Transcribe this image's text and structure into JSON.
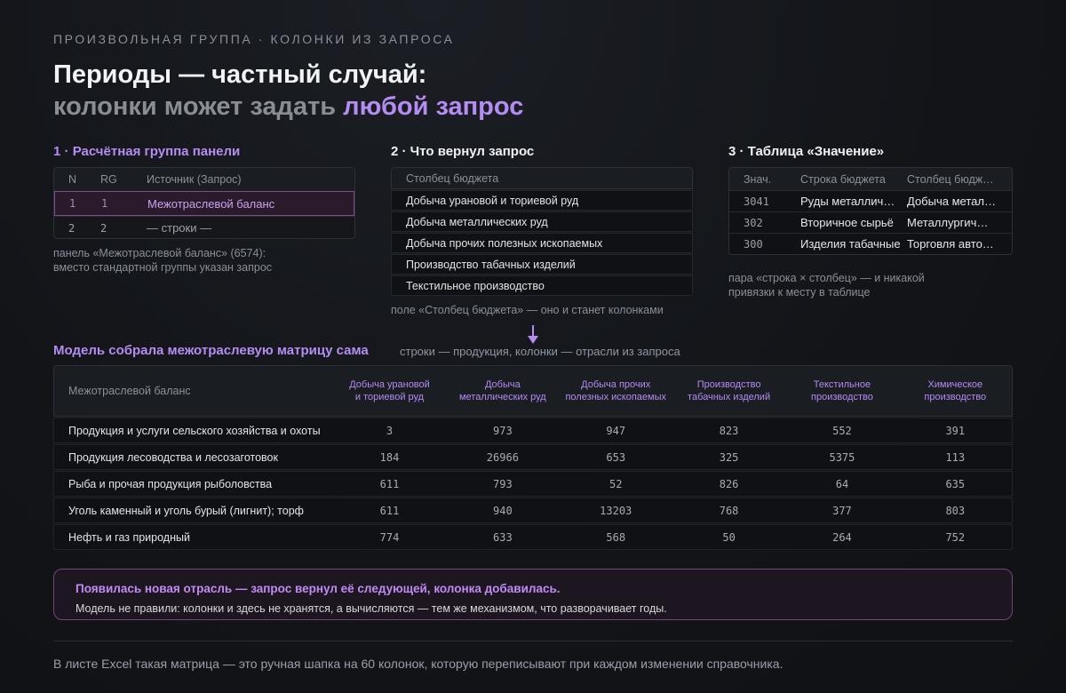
{
  "eyebrow": "ПРОИЗВОЛЬНАЯ ГРУППА · КОЛОНКИ ИЗ ЗАПРОСА",
  "title": {
    "line1": "Периоды — частный случай:",
    "line2_prefix": "колонки может задать ",
    "line2_accent": "любой запрос"
  },
  "section1": {
    "num": "1 · ",
    "title": "Расчётная группа панели",
    "headers": [
      "N",
      "RG",
      "Источник (Запрос)"
    ],
    "rows": [
      [
        "1",
        "1",
        "Межотраслевой баланс"
      ],
      [
        "2",
        "2",
        "— строки —"
      ]
    ],
    "note_line1": "панель «Межотраслевой баланс» (6574):",
    "note_line2": "вместо стандартной группы указан запрос"
  },
  "section2": {
    "title": "2 · Что вернул запрос",
    "header": "Столбец бюджета",
    "items": [
      "Добыча урановой и ториевой руд",
      "Добыча металлических руд",
      "Добыча прочих полезных ископаемых",
      "Производство табачных изделий",
      "Текстильное производство"
    ],
    "note": "поле «Столбец бюджета» — оно и станет колонками"
  },
  "section3": {
    "title": "3 · Таблица «Значение»",
    "headers": [
      "Знач.",
      "Строка бюджета",
      "Столбец бюджета"
    ],
    "rows": [
      [
        "3041",
        "Руды металлич…",
        "Добыча металл…"
      ],
      [
        "302",
        "Вторичное сырьё",
        "Металлургич…"
      ],
      [
        "300",
        "Изделия табачные",
        "Торговля авто…"
      ]
    ],
    "note_line1": "пара «строка × столбец» — и никакой",
    "note_line2": "привязки к месту в таблице"
  },
  "model": {
    "title": "Модель собрала межотраслевую матрицу сама",
    "subtitle": "строки — продукция, колонки — отрасли из запроса"
  },
  "matrix": {
    "corner": "Межотраслевой баланс",
    "columns": [
      [
        "Добыча урановой",
        "и ториевой руд"
      ],
      [
        "Добыча",
        "металлических руд"
      ],
      [
        "Добыча прочих",
        "полезных ископаемых"
      ],
      [
        "Производство",
        "табачных изделий"
      ],
      [
        "Текстильное",
        "производство"
      ],
      [
        "Химическое",
        "производство"
      ]
    ],
    "rows": [
      {
        "label": "Продукция и услуги сельского хозяйства и охоты",
        "values": [
          "3",
          "973",
          "947",
          "823",
          "552",
          "391"
        ]
      },
      {
        "label": "Продукция лесоводства и лесозаготовок",
        "values": [
          "184",
          "26966",
          "653",
          "325",
          "5375",
          "113"
        ]
      },
      {
        "label": "Рыба и прочая продукция рыболовства",
        "values": [
          "611",
          "793",
          "52",
          "826",
          "64",
          "635"
        ]
      },
      {
        "label": "Уголь каменный и уголь бурый (лигнит); торф",
        "values": [
          "611",
          "940",
          "13203",
          "768",
          "377",
          "803"
        ]
      },
      {
        "label": "Нефть и газ природный",
        "values": [
          "774",
          "633",
          "568",
          "50",
          "264",
          "752"
        ]
      }
    ]
  },
  "callout": {
    "heading": "Появилась новая отрасль — запрос вернул её следующей, колонка добавилась.",
    "body": "Модель не правили: колонки и здесь не хранятся, а вычисляются — тем же механизмом, что разворачивает годы."
  },
  "footer": "В листе Excel такая матрица — это ручная шапка на 60 колонок, которую переписывают при каждом изменении справочника.",
  "colors": {
    "accent": "#b48cf2",
    "background": "#121418",
    "highlight_row": "#2a1a2b",
    "callout_border": "#6b4a7a"
  },
  "icons": {
    "arrow": "arrow-down-icon"
  }
}
